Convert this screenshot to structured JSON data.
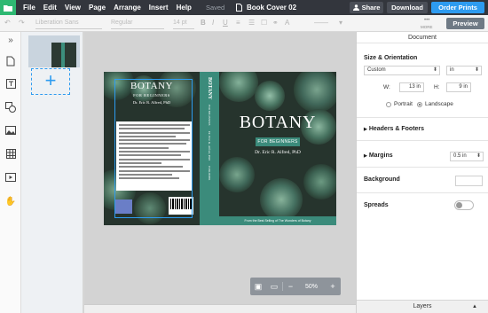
{
  "menu": [
    "File",
    "Edit",
    "View",
    "Page",
    "Arrange",
    "Insert",
    "Help"
  ],
  "saved_status": "Saved",
  "doc_title": "Book Cover 02",
  "top_buttons": {
    "share": "Share",
    "download": "Download",
    "order": "Order Prints"
  },
  "toolbar": {
    "font_family": "Liberation Sans",
    "font_weight": "Regular",
    "font_size": "14 pt",
    "bold": "B",
    "italic": "I",
    "underline": "U",
    "line_style": "——",
    "more": "MORE",
    "preview": "Preview"
  },
  "left_rail_icons": [
    "collapse-icon",
    "page-icon",
    "text-icon",
    "shapes-icon",
    "image-icon",
    "table-icon",
    "media-icon",
    "hand-icon"
  ],
  "add_page": "+",
  "cover": {
    "back_title": "BOTANY",
    "back_subtitle": "FOR BEGINNERS",
    "back_author": "Dr. Eric R. Alfred, PhD",
    "spine_title": "BOTANY",
    "spine_subtitle": "FOR BEGINNERS",
    "spine_author": "Dr. Eric R. Alfred, PhD",
    "spine_publisher": "PUBLISHER",
    "front_title": "BOTANY",
    "front_subtitle": "FOR BEGINNERS",
    "front_author": "Dr. Eric R. Alfred, PhD",
    "front_footer": "From the Best Selling of The Wonders of Botany"
  },
  "zoom": {
    "minus": "−",
    "value": "50%",
    "plus": "+"
  },
  "right_panel": {
    "title": "Document",
    "size_orientation": "Size & Orientation",
    "preset": "Custom",
    "unit": "in",
    "width_label": "W:",
    "width_value": "13 in",
    "height_label": "H:",
    "height_value": "9 in",
    "portrait": "Portrait",
    "landscape": "Landscape",
    "headers_footers": "Headers & Footers",
    "margins": "Margins",
    "margins_value": "0.5 in",
    "background": "Background",
    "spreads": "Spreads",
    "layers": "Layers"
  },
  "colors": {
    "accent": "#2d9bf0",
    "topbar": "#33363d",
    "brand_green": "#2eb872",
    "spine_teal": "#3b8b7b"
  }
}
